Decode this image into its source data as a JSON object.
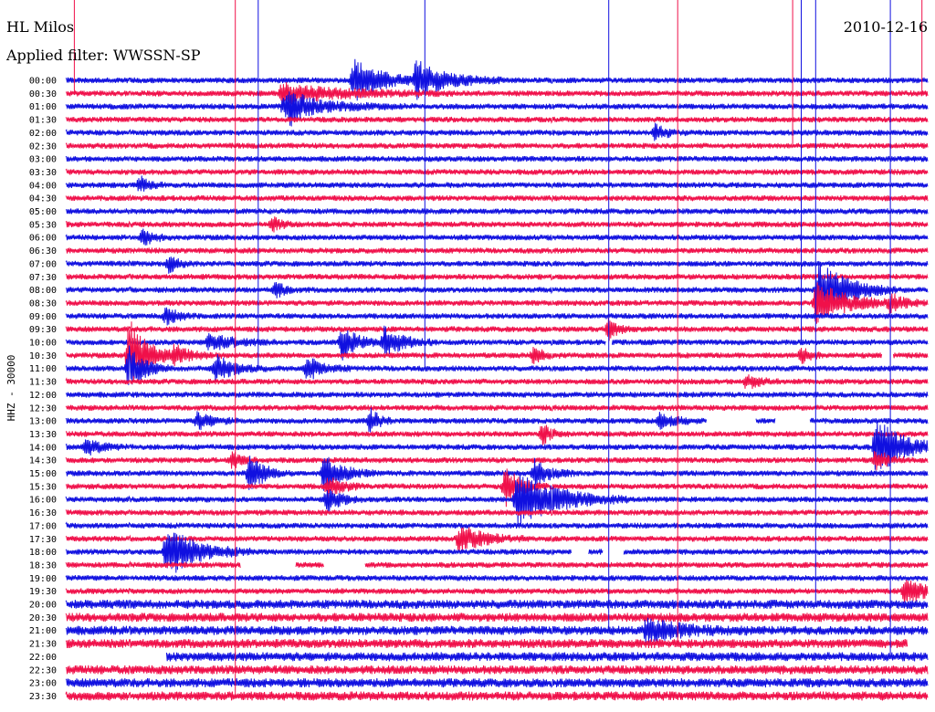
{
  "header": {
    "station": "HL Milos",
    "date": "2010-12-16",
    "filter": "Applied filter: WWSSN-SP"
  },
  "ylabel": "HHZ - 30000",
  "colors": {
    "even": "#1010e0",
    "odd": "#f0104a",
    "text": "#000000",
    "background": "#ffffff"
  },
  "chart_data": {
    "type": "line",
    "title": "HL Milos",
    "date": "2010-12-16",
    "filter": "WWSSN-SP",
    "ylabel": "HHZ - 30000",
    "trace_minutes": 30,
    "rows": [
      "00:00",
      "00:30",
      "01:00",
      "01:30",
      "02:00",
      "02:30",
      "03:00",
      "03:30",
      "04:00",
      "04:30",
      "05:00",
      "05:30",
      "06:00",
      "06:30",
      "07:00",
      "07:30",
      "08:00",
      "08:30",
      "09:00",
      "09:30",
      "10:00",
      "10:30",
      "11:00",
      "11:30",
      "12:00",
      "12:30",
      "13:00",
      "13:30",
      "14:00",
      "14:30",
      "15:00",
      "15:30",
      "16:00",
      "16:30",
      "17:00",
      "17:30",
      "18:00",
      "18:30",
      "19:00",
      "19:30",
      "20:00",
      "20:30",
      "21:00",
      "21:30",
      "22:00",
      "22:30",
      "23:00",
      "23:30"
    ],
    "events": [
      {
        "row": 0,
        "min": 10.0,
        "amp": 2.6,
        "dur": 0.9
      },
      {
        "row": 0,
        "min": 12.2,
        "amp": 2.2,
        "dur": 1.0
      },
      {
        "row": 1,
        "min": 7.5,
        "amp": 1.2,
        "dur": 2.0
      },
      {
        "row": 2,
        "min": 7.6,
        "amp": 1.2,
        "dur": 1.5
      },
      {
        "row": 2,
        "min": 7.8,
        "amp": 1.8,
        "dur": 0.3
      },
      {
        "row": 4,
        "min": 20.5,
        "amp": 0.9,
        "dur": 0.4
      },
      {
        "row": 8,
        "min": 2.6,
        "amp": 1.0,
        "dur": 0.3
      },
      {
        "row": 11,
        "min": 7.2,
        "amp": 0.8,
        "dur": 0.3
      },
      {
        "row": 12,
        "min": 2.7,
        "amp": 0.9,
        "dur": 0.4
      },
      {
        "row": 14,
        "min": 3.6,
        "amp": 1.0,
        "dur": 0.3
      },
      {
        "row": 16,
        "min": 7.3,
        "amp": 1.0,
        "dur": 0.3
      },
      {
        "row": 16,
        "min": 26.2,
        "amp": 3.8,
        "dur": 0.9
      },
      {
        "row": 17,
        "min": 26.1,
        "amp": 2.6,
        "dur": 1.0
      },
      {
        "row": 17,
        "min": 28.7,
        "amp": 1.0,
        "dur": 0.5
      },
      {
        "row": 18,
        "min": 3.5,
        "amp": 1.0,
        "dur": 0.4
      },
      {
        "row": 19,
        "min": 18.9,
        "amp": 1.2,
        "dur": 0.3
      },
      {
        "row": 20,
        "min": 5.0,
        "amp": 1.0,
        "dur": 0.8
      },
      {
        "row": 20,
        "min": 9.6,
        "amp": 2.0,
        "dur": 0.5
      },
      {
        "row": 20,
        "min": 11.1,
        "amp": 1.8,
        "dur": 0.6
      },
      {
        "row": 21,
        "min": 2.2,
        "amp": 4.5,
        "dur": 0.6
      },
      {
        "row": 21,
        "min": 3.8,
        "amp": 1.0,
        "dur": 0.6
      },
      {
        "row": 21,
        "min": 16.3,
        "amp": 1.0,
        "dur": 0.3
      },
      {
        "row": 21,
        "min": 25.6,
        "amp": 0.9,
        "dur": 0.3
      },
      {
        "row": 22,
        "min": 2.2,
        "amp": 2.5,
        "dur": 0.5
      },
      {
        "row": 22,
        "min": 5.2,
        "amp": 1.6,
        "dur": 0.6
      },
      {
        "row": 22,
        "min": 8.4,
        "amp": 1.5,
        "dur": 0.5
      },
      {
        "row": 23,
        "min": 23.7,
        "amp": 0.9,
        "dur": 0.4
      },
      {
        "row": 26,
        "min": 4.6,
        "amp": 1.0,
        "dur": 0.5
      },
      {
        "row": 26,
        "min": 10.6,
        "amp": 1.5,
        "dur": 0.3
      },
      {
        "row": 26,
        "min": 20.7,
        "amp": 1.0,
        "dur": 0.5
      },
      {
        "row": 27,
        "min": 16.6,
        "amp": 1.2,
        "dur": 0.3
      },
      {
        "row": 28,
        "min": 0.7,
        "amp": 1.0,
        "dur": 0.5
      },
      {
        "row": 28,
        "min": 28.2,
        "amp": 3.5,
        "dur": 0.9
      },
      {
        "row": 29,
        "min": 5.8,
        "amp": 1.0,
        "dur": 0.3
      },
      {
        "row": 29,
        "min": 28.2,
        "amp": 1.3,
        "dur": 0.4
      },
      {
        "row": 30,
        "min": 6.4,
        "amp": 2.2,
        "dur": 0.5
      },
      {
        "row": 30,
        "min": 9.0,
        "amp": 2.2,
        "dur": 0.6
      },
      {
        "row": 30,
        "min": 16.3,
        "amp": 1.6,
        "dur": 0.5
      },
      {
        "row": 31,
        "min": 9.1,
        "amp": 1.2,
        "dur": 0.5
      },
      {
        "row": 31,
        "min": 15.3,
        "amp": 2.4,
        "dur": 0.5
      },
      {
        "row": 32,
        "min": 9.1,
        "amp": 1.8,
        "dur": 0.4
      },
      {
        "row": 32,
        "min": 15.7,
        "amp": 3.5,
        "dur": 1.3
      },
      {
        "row": 35,
        "min": 13.7,
        "amp": 1.6,
        "dur": 0.8
      },
      {
        "row": 36,
        "min": 3.5,
        "amp": 3.2,
        "dur": 1.0
      },
      {
        "row": 39,
        "min": 29.2,
        "amp": 1.4,
        "dur": 0.9
      },
      {
        "row": 42,
        "min": 20.2,
        "amp": 1.2,
        "dur": 1.2
      }
    ],
    "gaps": [
      {
        "row": 26,
        "from": 22.3,
        "to": 24.0
      },
      {
        "row": 26,
        "from": 24.7,
        "to": 25.9
      },
      {
        "row": 36,
        "from": 17.6,
        "to": 18.2
      },
      {
        "row": 36,
        "from": 18.7,
        "to": 19.4
      },
      {
        "row": 37,
        "from": 6.1,
        "to": 8.0
      },
      {
        "row": 37,
        "from": 9.0,
        "to": 10.4
      },
      {
        "row": 44,
        "from": 0.0,
        "to": 3.5
      },
      {
        "row": 43,
        "from": 29.3,
        "to": 30.0
      },
      {
        "row": 21,
        "from": 28.4,
        "to": 28.8
      },
      {
        "row": 20,
        "from": 18.8,
        "to": 19.0
      }
    ],
    "spikes": [
      {
        "min": 0.3,
        "from": 0,
        "to": 1
      },
      {
        "min": 5.9,
        "from": 0,
        "to": 47
      },
      {
        "min": 6.7,
        "from": 0,
        "to": 22
      },
      {
        "min": 12.5,
        "from": 0,
        "to": 22
      },
      {
        "min": 18.9,
        "from": 0,
        "to": 42
      },
      {
        "min": 21.3,
        "from": 0,
        "to": 43
      },
      {
        "min": 25.3,
        "from": 0,
        "to": 5
      },
      {
        "min": 25.6,
        "from": 0,
        "to": 20
      },
      {
        "min": 26.1,
        "from": 0,
        "to": 40
      },
      {
        "min": 28.7,
        "from": 0,
        "to": 44
      },
      {
        "min": 29.8,
        "from": 0,
        "to": 1
      }
    ]
  }
}
